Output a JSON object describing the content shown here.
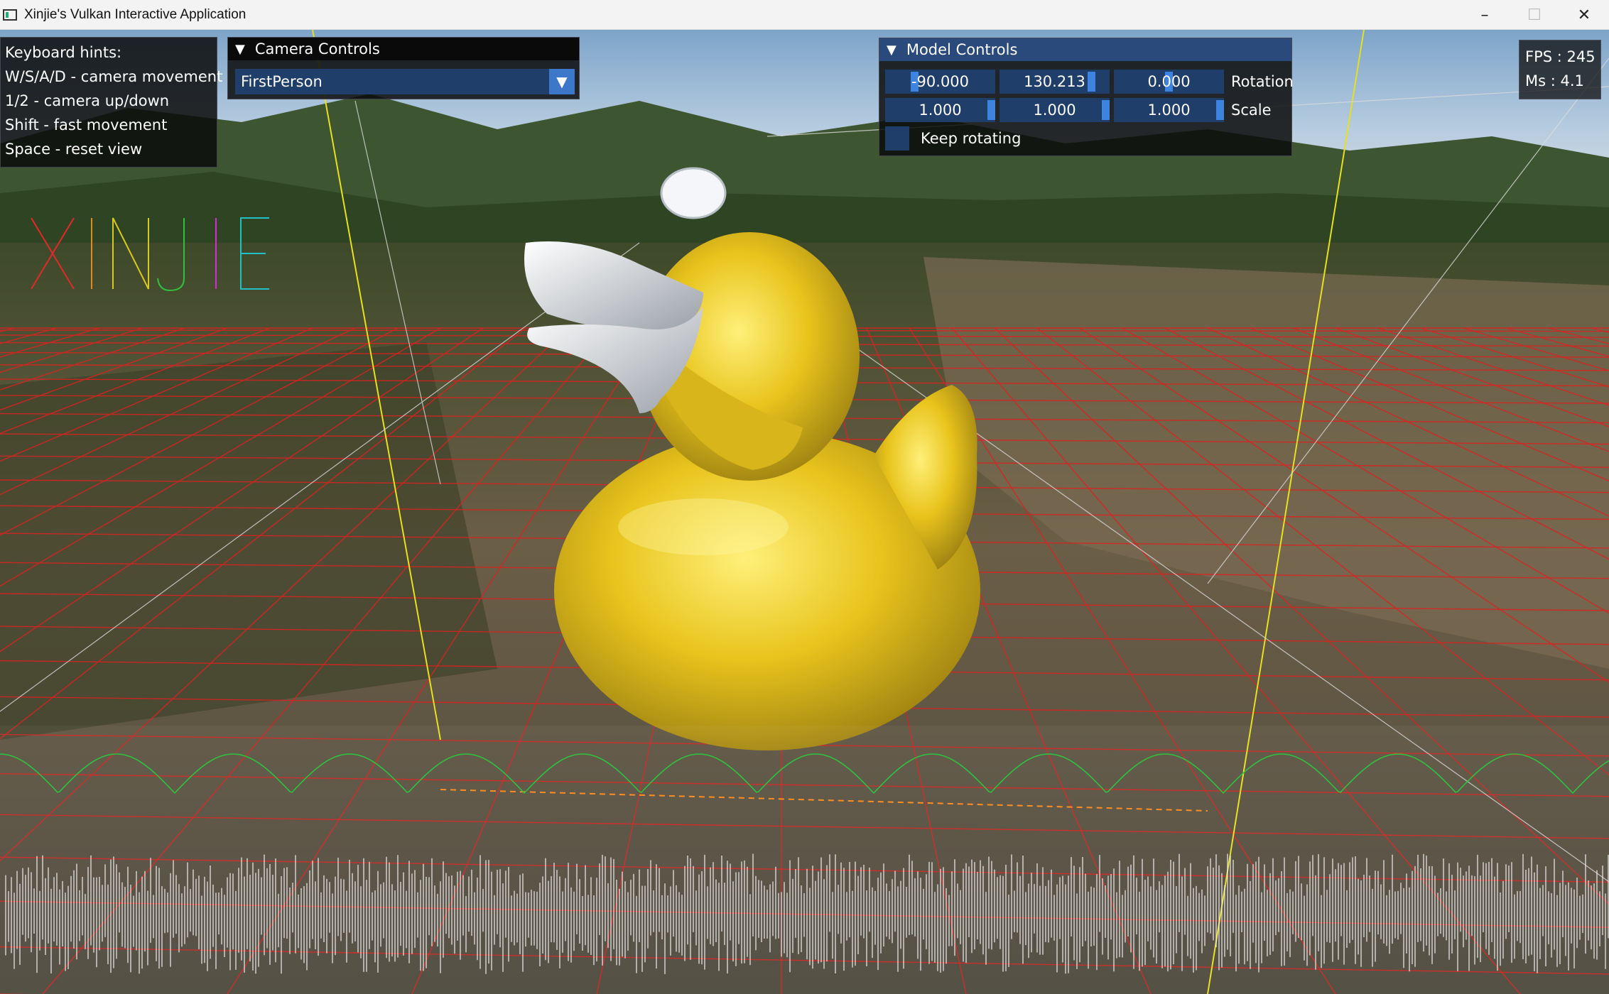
{
  "window": {
    "title": "Xinjie's Vulkan Interactive Application",
    "controls": {
      "minimize": "–",
      "maximize": "☐",
      "close": "✕"
    }
  },
  "keyboard_hints": {
    "title": "Keyboard hints:",
    "items": [
      "W/S/A/D - camera movement",
      "1/2 - camera up/down",
      "Shift - fast movement",
      "Space - reset view"
    ]
  },
  "camera_controls": {
    "header": "Camera Controls",
    "mode_value": "FirstPerson"
  },
  "model_controls": {
    "header": "Model Controls",
    "rotation": {
      "label": "Rotation",
      "values": [
        "-90.000",
        "130.213",
        "0.000"
      ]
    },
    "scale": {
      "label": "Scale",
      "values": [
        "1.000",
        "1.000",
        "1.000"
      ]
    },
    "keep_rotating_label": "Keep rotating"
  },
  "stats": {
    "fps": "FPS : 245",
    "ms": "Ms  : 4.1"
  },
  "logo_text": "XINJIE",
  "colors": {
    "accent": "#294a7a",
    "widget_bg": "#1f3e69",
    "grab": "#3d84e0",
    "grid": "#e02020",
    "duck": "#e3c21a"
  },
  "icons": {
    "collapse": "triangle-down-icon",
    "combo_arrow": "triangle-down-icon",
    "app": "window-app-icon"
  }
}
